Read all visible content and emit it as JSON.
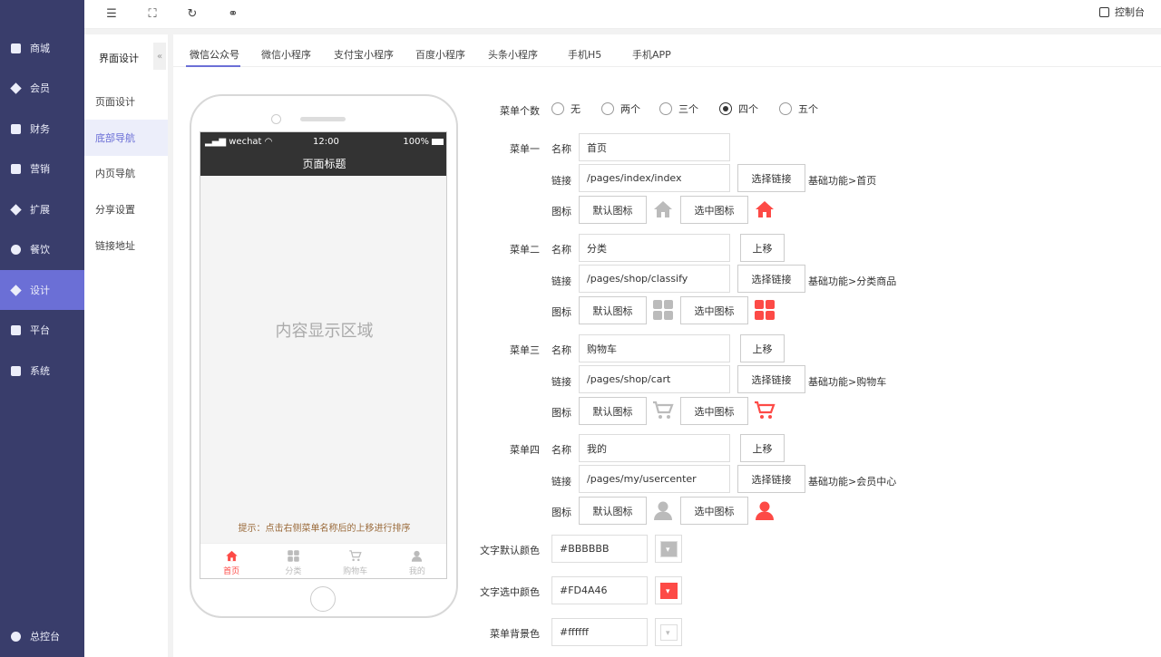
{
  "sidebar": {
    "items": [
      {
        "label": "商城",
        "icon": "shop-icon"
      },
      {
        "label": "会员",
        "icon": "member-icon"
      },
      {
        "label": "财务",
        "icon": "finance-icon"
      },
      {
        "label": "营销",
        "icon": "marketing-icon"
      },
      {
        "label": "扩展",
        "icon": "extension-icon"
      },
      {
        "label": "餐饮",
        "icon": "restaurant-icon"
      },
      {
        "label": "设计",
        "icon": "design-icon"
      },
      {
        "label": "平台",
        "icon": "platform-icon"
      },
      {
        "label": "系统",
        "icon": "system-icon"
      }
    ],
    "footer": "总控台",
    "active_index": 6
  },
  "topbar": {
    "console": "控制台",
    "icons": [
      "menu-fold-icon",
      "fullscreen-icon",
      "refresh-icon",
      "link-icon"
    ]
  },
  "subnav": {
    "title": "界面设计",
    "collapse": "«",
    "items": [
      "页面设计",
      "底部导航",
      "内页导航",
      "分享设置",
      "链接地址"
    ],
    "active_index": 1
  },
  "tabs": [
    "微信公众号",
    "微信小程序",
    "支付宝小程序",
    "百度小程序",
    "头条小程序",
    "手机H5",
    "手机APP"
  ],
  "phone": {
    "carrier": "wechat",
    "time": "12:00",
    "battery": "100%",
    "page_title": "页面标题",
    "content": "内容显示区域",
    "hint": "提示：点击右侧菜单名称后的上移进行排序",
    "tabbar": [
      "首页",
      "分类",
      "购物车",
      "我的"
    ]
  },
  "form": {
    "count_label": "菜单个数",
    "count_options": [
      "无",
      "两个",
      "三个",
      "四个",
      "五个"
    ],
    "count_selected": 3,
    "name_label": "名称",
    "link_label": "链接",
    "icon_label": "图标",
    "choose_link": "选择链接",
    "default_icon": "默认图标",
    "selected_icon": "选中图标",
    "move_up": "上移",
    "menus": [
      {
        "title": "菜单一",
        "name": "首页",
        "link": "/pages/index/index",
        "desc": "基础功能>首页",
        "icon": "home-icon"
      },
      {
        "title": "菜单二",
        "name": "分类",
        "link": "/pages/shop/classify",
        "desc": "基础功能>分类商品",
        "icon": "category-icon"
      },
      {
        "title": "菜单三",
        "name": "购物车",
        "link": "/pages/shop/cart",
        "desc": "基础功能>购物车",
        "icon": "cart-icon"
      },
      {
        "title": "菜单四",
        "name": "我的",
        "link": "/pages/my/usercenter",
        "desc": "基础功能>会员中心",
        "icon": "user-icon"
      }
    ],
    "text_default_color_label": "文字默认颜色",
    "text_default_color": "#BBBBBB",
    "text_selected_color_label": "文字选中颜色",
    "text_selected_color": "#FD4A46",
    "menu_bg_color_label": "菜单背景色",
    "menu_bg_color": "#ffffff"
  },
  "colors": {
    "accent": "#6b6fd6",
    "sidebar": "#393d6b",
    "icon_gray": "#bbbbbb",
    "icon_red": "#fd4a46"
  }
}
